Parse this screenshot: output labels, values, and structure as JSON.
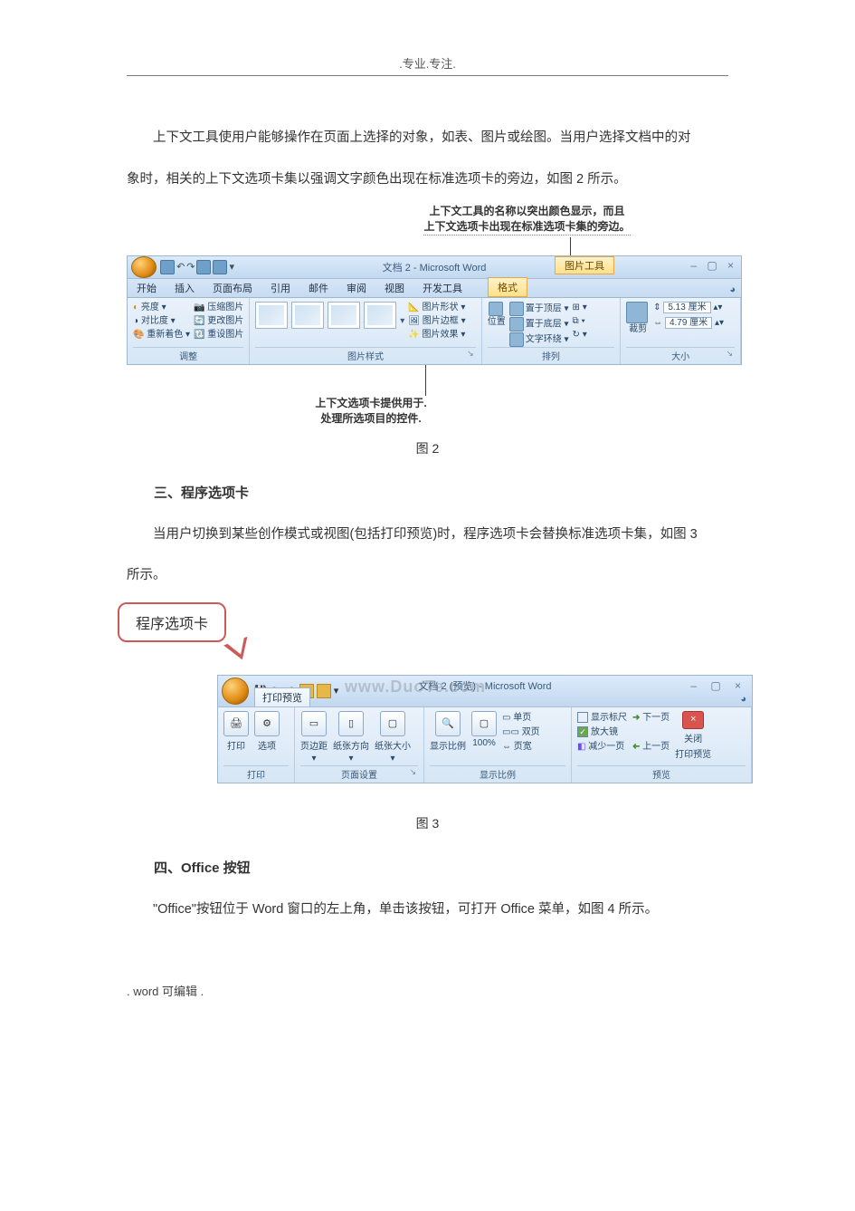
{
  "header": ".专业.专注.",
  "para1_l1": "上下文工具使用户能够操作在页面上选择的对象，如表、图片或绘图。当用户选择文档中的对",
  "para1_l2": "象时，相关的上下文选项卡集以强调文字颜色出现在标准选项卡的旁边，如图 2 所示。",
  "fig2_caption": "图 2",
  "section3_title": "三、程序选项卡",
  "para2_l1": "当用户切换到某些创作模式或视图(包括打印预览)时，程序选项卡会替换标准选项卡集，如图 3",
  "para2_l2": "所示。",
  "fig3_caption": "图 3",
  "section4_title": "四、Office 按钮",
  "para3": "\"Office\"按钮位于 Word 窗口的左上角，单击该按钮，可打开 Office 菜单，如图 4 所示。",
  "footer": ".   word 可编辑   .",
  "fig2": {
    "callout_top_l1": "上下文工具的名称以突出颜色显示，而且",
    "callout_top_l2": "上下文选项卡出现在标准选项卡集的旁边。",
    "callout_bot_l1": "上下文选项卡提供用于.",
    "callout_bot_l2": "处理所选项目的控件.",
    "title": "文档 2 - Microsoft Word",
    "ctx_tool": "图片工具",
    "tabs": {
      "t1": "开始",
      "t2": "插入",
      "t3": "页面布局",
      "t4": "引用",
      "t5": "邮件",
      "t6": "审阅",
      "t7": "视图",
      "t8": "开发工具",
      "fmt": "格式"
    },
    "grp_adjust": {
      "label": "调整",
      "brightness": "亮度 ▾",
      "compress": "📷 压缩图片",
      "contrast": "对比度 ▾",
      "change": "🔄 更改图片",
      "recolor": "重新着色 ▾",
      "reset": "🔃 重设图片"
    },
    "grp_styles": {
      "label": "图片样式",
      "shape": "📐 图片形状 ▾",
      "border": "🖼 图片边框 ▾",
      "effects": "✨ 图片效果 ▾"
    },
    "grp_arrange": {
      "label": "排列",
      "front": "置于顶层 ▾",
      "align": "⊞ ▾",
      "back": "置于底层 ▾",
      "group": "⧉ ▾",
      "wrap": "文字环绕 ▾",
      "rotate": "↻ ▾",
      "pos": "位置"
    },
    "grp_size": {
      "label": "大小",
      "crop": "裁剪",
      "h": "5.13 厘米",
      "w": "4.79 厘米"
    }
  },
  "fig3": {
    "callout_label": "程序选项卡",
    "title": "文档 2 (预览) - Microsoft Word",
    "tab": "打印预览",
    "watermark": "www.DuoTe.com",
    "grp_print": {
      "label": "打印",
      "print": "打印",
      "options": "选项"
    },
    "grp_page": {
      "label": "页面设置",
      "margins": "页边距",
      "orient": "纸张方向",
      "size": "纸张大小"
    },
    "grp_zoom": {
      "label": "显示比例",
      "zoom": "显示比例",
      "hundred": "100%",
      "single": "单页",
      "two": "双页",
      "width": "页宽"
    },
    "grp_preview": {
      "label": "预览",
      "ruler": "显示标尺",
      "magnify": "放大镜",
      "shrink": "减少一页",
      "next": "下一页",
      "prev": "上一页",
      "close": "关闭",
      "close2": "打印预览"
    }
  }
}
